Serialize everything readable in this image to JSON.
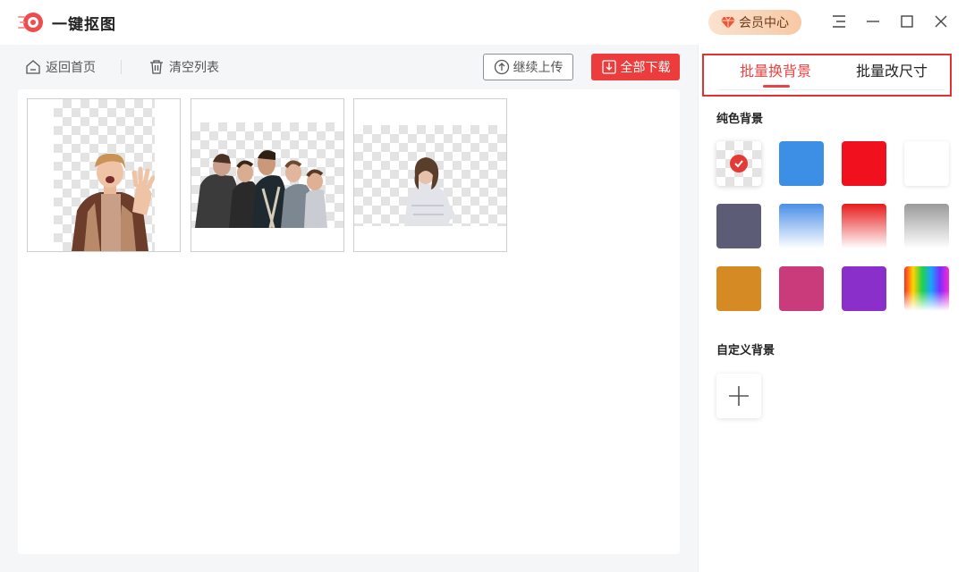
{
  "app": {
    "title": "一键抠图"
  },
  "header": {
    "vip_label": "会员中心"
  },
  "toolbar": {
    "home_label": "返回首页",
    "clear_label": "清空列表",
    "upload_label": "继续上传",
    "download_label": "全部下载"
  },
  "images": [
    {
      "subject": "woman-waving"
    },
    {
      "subject": "group-of-friends"
    },
    {
      "subject": "girl-walking"
    }
  ],
  "panel": {
    "tabs": [
      {
        "label": "批量换背景",
        "active": true
      },
      {
        "label": "批量改尺寸",
        "active": false
      }
    ],
    "solid_label": "纯色背景",
    "custom_label": "自定义背景",
    "swatches": [
      {
        "name": "transparent",
        "selected": true
      },
      {
        "name": "blue",
        "color": "#3d8fe6"
      },
      {
        "name": "red",
        "color": "#f0101e"
      },
      {
        "name": "white",
        "color": "#ffffff"
      },
      {
        "name": "slate",
        "color": "#5d5c77"
      },
      {
        "name": "blue-gradient",
        "color": "#4a8fe8"
      },
      {
        "name": "red-gradient",
        "color": "#e81a1a"
      },
      {
        "name": "gray-gradient",
        "color": "#9a9a9a"
      },
      {
        "name": "orange",
        "color": "#d68a23"
      },
      {
        "name": "pink",
        "color": "#c93b7a"
      },
      {
        "name": "purple",
        "color": "#8a2fca"
      },
      {
        "name": "rainbow"
      }
    ]
  },
  "colors": {
    "accent": "#e94444",
    "primary_button": "#ec3c3c"
  }
}
